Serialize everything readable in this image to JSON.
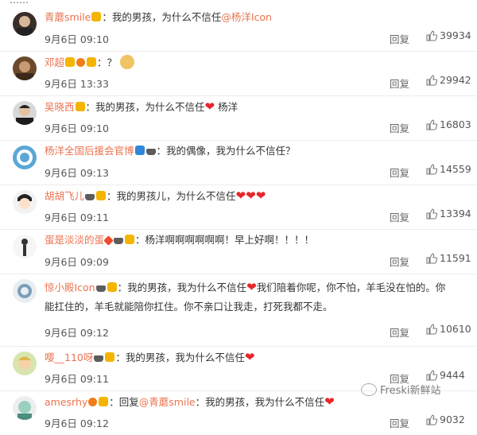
{
  "colors": {
    "name": "#eb7350",
    "heart": "#e8262a",
    "text": "#333333"
  },
  "reply_label": "回复",
  "watermark": "Freski新鲜站",
  "comments": [
    {
      "name": "青蘑smile",
      "text": "：我的男孩，为什么不信任",
      "mention": "@杨洋Icon",
      "time": "9月6日 09:10",
      "likes": "39934"
    },
    {
      "name": "邓超",
      "text": "：？",
      "time": "9月6日 13:33",
      "likes": "29942"
    },
    {
      "name": "吴晓西",
      "text": "：我的男孩，为什么不信任",
      "after": "杨洋",
      "time": "9月6日 09:10",
      "likes": "16803"
    },
    {
      "name": "杨洋全国后援会官博",
      "text": "：我的偶像，我为什么不信任？",
      "time": "9月6日 09:13",
      "likes": "14559"
    },
    {
      "name": "胡胡飞儿",
      "text": "：我的男孩儿，为什么不信任",
      "time": "9月6日 09:11",
      "likes": "13394"
    },
    {
      "name": "蛋是淡淡的蛋",
      "text": "：杨洋啊啊啊啊啊啊！早上好啊！！！！",
      "time": "9月6日 09:09",
      "likes": "11591"
    },
    {
      "name": "惊小殿Icon",
      "text": "：我的男孩，我为什么不信任",
      "text2": "我们陪着你呢，你不怕，羊毛没在怕的。你",
      "text3": "能扛住的，羊毛就能陪你扛住。你不亲口让我走，打死我都不走。",
      "time": "9月6日 09:12",
      "likes": "10610"
    },
    {
      "name": "嘤__110呀",
      "text": "：我的男孩，我为什么不信任",
      "time": "9月6日 09:11",
      "likes": "9444"
    },
    {
      "name": "amesrhy",
      "text": "：回复",
      "mention": "@青蘑smile",
      "text4": "：我的男孩，我为什么不信任",
      "time": "9月6日 09:12",
      "likes": "9032"
    }
  ]
}
